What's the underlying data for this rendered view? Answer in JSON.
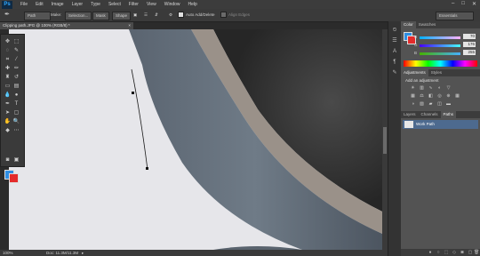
{
  "app": {
    "logo": "Ps"
  },
  "menu": [
    "File",
    "Edit",
    "Image",
    "Layer",
    "Type",
    "Select",
    "Filter",
    "View",
    "Window",
    "Help"
  ],
  "window_controls": [
    "–",
    "□",
    "✕"
  ],
  "options_bar": {
    "mode_select": "Path",
    "make_label": "Make:",
    "selection_btn": "Selection...",
    "mask_btn": "Mask",
    "shape_btn": "Shape",
    "auto_add_delete": "Auto Add/Delete",
    "align_edges": "Align Edges",
    "workspace": "Essentials"
  },
  "document": {
    "tab_title": "Clipping path.JPG @ 100% (RGB/8) *",
    "close": "×"
  },
  "status_bar": {
    "zoom": "100%",
    "doc_info": "Doc: 11.3M/11.3M"
  },
  "panels": {
    "color": {
      "tabs": [
        "Color",
        "Swatches"
      ],
      "sliders": [
        {
          "label": "R",
          "value": "70"
        },
        {
          "label": "G",
          "value": "176"
        },
        {
          "label": "B",
          "value": "255"
        }
      ],
      "fg": "#2f8de2",
      "bg": "#e42b2b"
    },
    "adjustments": {
      "tabs": [
        "Adjustments",
        "Styles"
      ],
      "title": "Add an adjustment"
    },
    "paths": {
      "tabs": [
        "Layers",
        "Channels",
        "Paths"
      ],
      "items": [
        {
          "name": "Work Path"
        }
      ]
    }
  },
  "colors": {
    "accent": "#31a8ff",
    "panel_bg": "#535353",
    "selected_row": "#4d6a8f"
  }
}
